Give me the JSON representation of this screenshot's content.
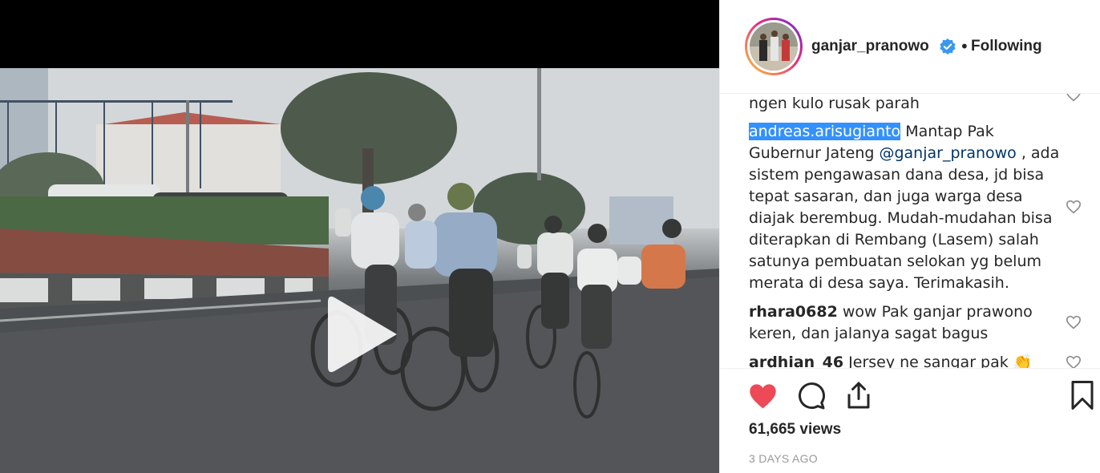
{
  "post": {
    "username": "ganjar_pranowo",
    "separator": "•",
    "follow_status": "Following"
  },
  "comments": [
    {
      "text": "ngen kulo rusak parah"
    },
    {
      "user": "andreas.arisugianto",
      "text_before": " Mantap Pak Gubernur Jateng ",
      "mention": "@ganjar_pranowo",
      "text_after": " , ada sistem pengawasan dana desa, jd bisa tepat sasaran, dan juga warga desa diajak berembug. Mudah-mudahan bisa diterapkan di Rembang (Lasem) salah satunya pembuatan selokan yg belum merata di desa saya. Terimakasih."
    },
    {
      "user": "rhara0682",
      "text": " wow Pak ganjar prawono keren, dan jalanya sagat bagus"
    },
    {
      "user": "ardhian_46",
      "text": " Jersey ne sangar pak 👏"
    }
  ],
  "stats": {
    "views": "61,665 views",
    "posted": "3 DAYS AGO"
  },
  "icons": {
    "like": "heart-filled-icon",
    "comment": "comment-bubble-icon",
    "share": "share-upload-icon",
    "save": "bookmark-icon",
    "play": "play-icon",
    "verified": "verified-badge-icon"
  },
  "colors": {
    "like_red": "#ed4956",
    "verified_blue": "#3897f0",
    "selection_blue": "#3390ff",
    "mention_blue": "#003569"
  }
}
